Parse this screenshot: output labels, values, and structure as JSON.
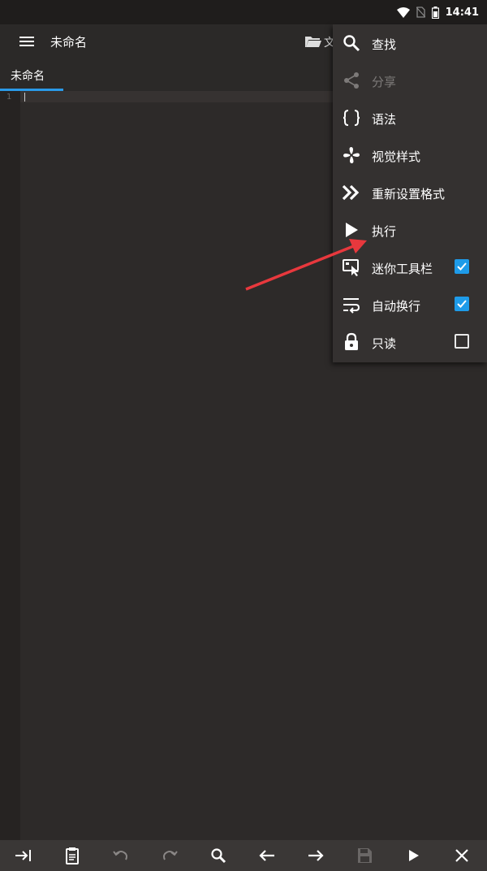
{
  "status_bar": {
    "time": "14:41"
  },
  "app_bar": {
    "title": "未命名",
    "folder_label": "文"
  },
  "tabs": [
    {
      "label": "未命名"
    }
  ],
  "editor": {
    "line_numbers": [
      "1"
    ]
  },
  "menu": {
    "items": [
      {
        "label": "查找",
        "icon": "search-icon"
      },
      {
        "label": "分享",
        "icon": "share-icon",
        "disabled": true
      },
      {
        "label": "语法",
        "icon": "braces-icon"
      },
      {
        "label": "视觉样式",
        "icon": "fan-icon"
      },
      {
        "label": "重新设置格式",
        "icon": "double-chevron-icon"
      },
      {
        "label": "执行",
        "icon": "play-icon"
      },
      {
        "label": "迷你工具栏",
        "icon": "mini-toolbar-icon",
        "checked": true
      },
      {
        "label": "自动换行",
        "icon": "wrap-icon",
        "checked": true
      },
      {
        "label": "只读",
        "icon": "lock-icon",
        "checked": false
      }
    ]
  },
  "bottom_toolbar": {
    "buttons": [
      "tab-icon",
      "clipboard-icon",
      "undo-icon",
      "redo-icon",
      "search-icon",
      "arrow-left-icon",
      "arrow-right-icon",
      "save-icon",
      "play-icon",
      "close-icon"
    ]
  },
  "colors": {
    "accent": "#1e9be9",
    "annotation_arrow": "#e8383d",
    "background": "#2d2a29",
    "menu_background": "#343130"
  }
}
